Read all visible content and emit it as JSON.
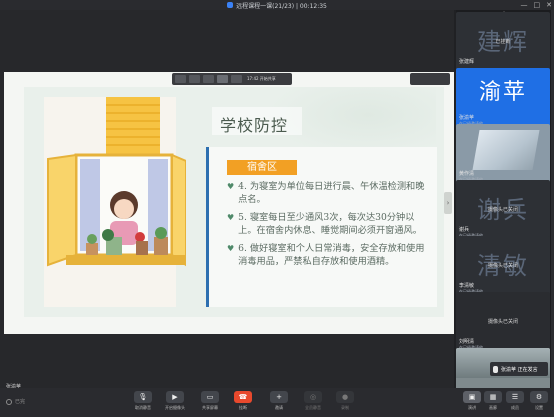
{
  "window": {
    "title": "远程课程一课(21/23) | 00:12:35",
    "controls": [
      "—",
      "□",
      "✕"
    ]
  },
  "share_toolbar": {
    "label": "17:42 开始共享"
  },
  "slide": {
    "title": "学校防控",
    "tag": "宿舍区",
    "items": [
      "4. 为寝室为单位每日进行晨、午休温检测和晚点名。",
      "5. 寝室每日至少通风3次，每次达30分钟以上。在宿舍内休息、睡觉期间必须开窗通风。",
      "6. 做好寝室和个人日常消毒，安全存放和使用消毒用品，严禁私自存放和使用酒精。"
    ]
  },
  "speaker": {
    "name": "张渝苹",
    "sub": "将他网路邀请"
  },
  "participants": [
    {
      "bigname": "建辉",
      "name": "张建辉",
      "sub": "",
      "overlay": "已挂断",
      "kind": "avatar"
    },
    {
      "bigname": "渝苹",
      "name": "张渝苹",
      "sub": "在已经邀请他",
      "overlay": "",
      "kind": "active"
    },
    {
      "bigname": "",
      "name": "黄作清",
      "sub": "在已经邀请他",
      "overlay": "",
      "kind": "camera"
    },
    {
      "bigname": "谢兵",
      "name": "谢兵",
      "sub": "在已经邀请他",
      "overlay": "摄像头已关闭",
      "kind": "avatar"
    },
    {
      "bigname": "清敏",
      "name": "李清敏",
      "sub": "在已经邀请他",
      "overlay": "摄像头已关闭",
      "kind": "avatar"
    },
    {
      "bigname": "",
      "name": "刘明清",
      "sub": "在已经邀请他",
      "overlay": "摄像头已关闭",
      "kind": "last"
    }
  ],
  "toast": {
    "text": "张渝苹 正在发言"
  },
  "footer_left": {
    "text": "已完"
  },
  "controls": [
    {
      "label": "取消静音",
      "icon": "mic-icon",
      "kind": "normal"
    },
    {
      "label": "开启摄像头",
      "icon": "camera-icon",
      "kind": "normal"
    },
    {
      "label": "共享屏幕",
      "icon": "screen-share-icon",
      "kind": "normal"
    },
    {
      "label": "挂断",
      "icon": "phone-end-icon",
      "kind": "end"
    },
    {
      "label": "邀请",
      "icon": "invite-icon",
      "kind": "normal"
    },
    {
      "label": "全员静音",
      "icon": "mute-all-icon",
      "kind": "disabled"
    },
    {
      "label": "录制",
      "icon": "record-icon",
      "kind": "disabled"
    }
  ],
  "right_controls": [
    {
      "label": "演讲",
      "icon": "speaker-view-icon",
      "kind": "view"
    },
    {
      "label": "画廊",
      "icon": "gallery-icon",
      "kind": "normal"
    },
    {
      "label": "成员",
      "icon": "members-icon",
      "kind": "normal"
    },
    {
      "label": "设置",
      "icon": "settings-icon",
      "kind": "normal"
    }
  ],
  "colors": {
    "accent_active": "#1f6fe5",
    "tag": "#f2a024",
    "end_call": "#e8492d",
    "slide_bar": "#2d6fb0"
  }
}
